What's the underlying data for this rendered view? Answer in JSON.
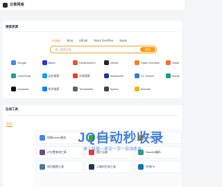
{
  "header": {
    "title": "云推网络"
  },
  "search_section": {
    "title": "搜索资源",
    "engines": [
      "Google",
      "Bing",
      "Github",
      "Stack Overflow",
      "Baidu"
    ],
    "active_engine": "Google",
    "placeholder": "输入搜索内容",
    "button_label": "搜索"
  },
  "links": [
    {
      "label": "Google",
      "color": "#4285f4"
    },
    {
      "label": "Baidu",
      "color": "#2932e1"
    },
    {
      "label": "DuckDuckGo",
      "color": "#de5833"
    },
    {
      "label": "Github",
      "color": "#24292e"
    },
    {
      "label": "Stack Overflow",
      "color": "#f48024"
    },
    {
      "label": "Gitlab",
      "color": "#fc6d26"
    },
    {
      "label": "CodeSmile",
      "color": "#2a9d8f"
    },
    {
      "label": "必应搜索",
      "color": "#00a4ef"
    },
    {
      "label": "头条搜索",
      "color": "#e33e33"
    },
    {
      "label": "Similarweb",
      "color": "#1f3a93"
    },
    {
      "label": "CC Search",
      "color": "#2a7fd4"
    },
    {
      "label": "Dianly",
      "color": "#12a37b"
    },
    {
      "label": "Unsplash",
      "color": "#111111"
    },
    {
      "label": "知乎搜索",
      "color": "#0084ff"
    },
    {
      "label": "TrendsWeb",
      "color": "#5a6268"
    },
    {
      "label": "Symbo",
      "color": "#444444"
    },
    {
      "label": "Beecide",
      "color": "#f5b400"
    }
  ],
  "tools_section": {
    "title": "在线工具",
    "tab_label": "常用",
    "tools": [
      {
        "label": "短链Weibo服务",
        "color": "#3a86ff"
      },
      {
        "label": "在线JSON工具",
        "color": "#38b000"
      },
      {
        "label": "Favicon生成",
        "color": "#ff8c00"
      },
      {
        "label": "IP位置查询工具",
        "color": "#6a4c93"
      },
      {
        "label": "图片压缩",
        "color": "#e63946"
      },
      {
        "label": "Base64编码",
        "color": "#2a9d8f"
      },
      {
        "label": "网页截图工具",
        "color": "#457b9d"
      },
      {
        "label": "二维码生成工具",
        "color": "#1d3557"
      },
      {
        "label": "在线PS",
        "color": "#0077b6"
      }
    ]
  },
  "watermark": {
    "main": "JQ自动秒收录",
    "sub": "快上链接一来访一次一自动收录"
  }
}
